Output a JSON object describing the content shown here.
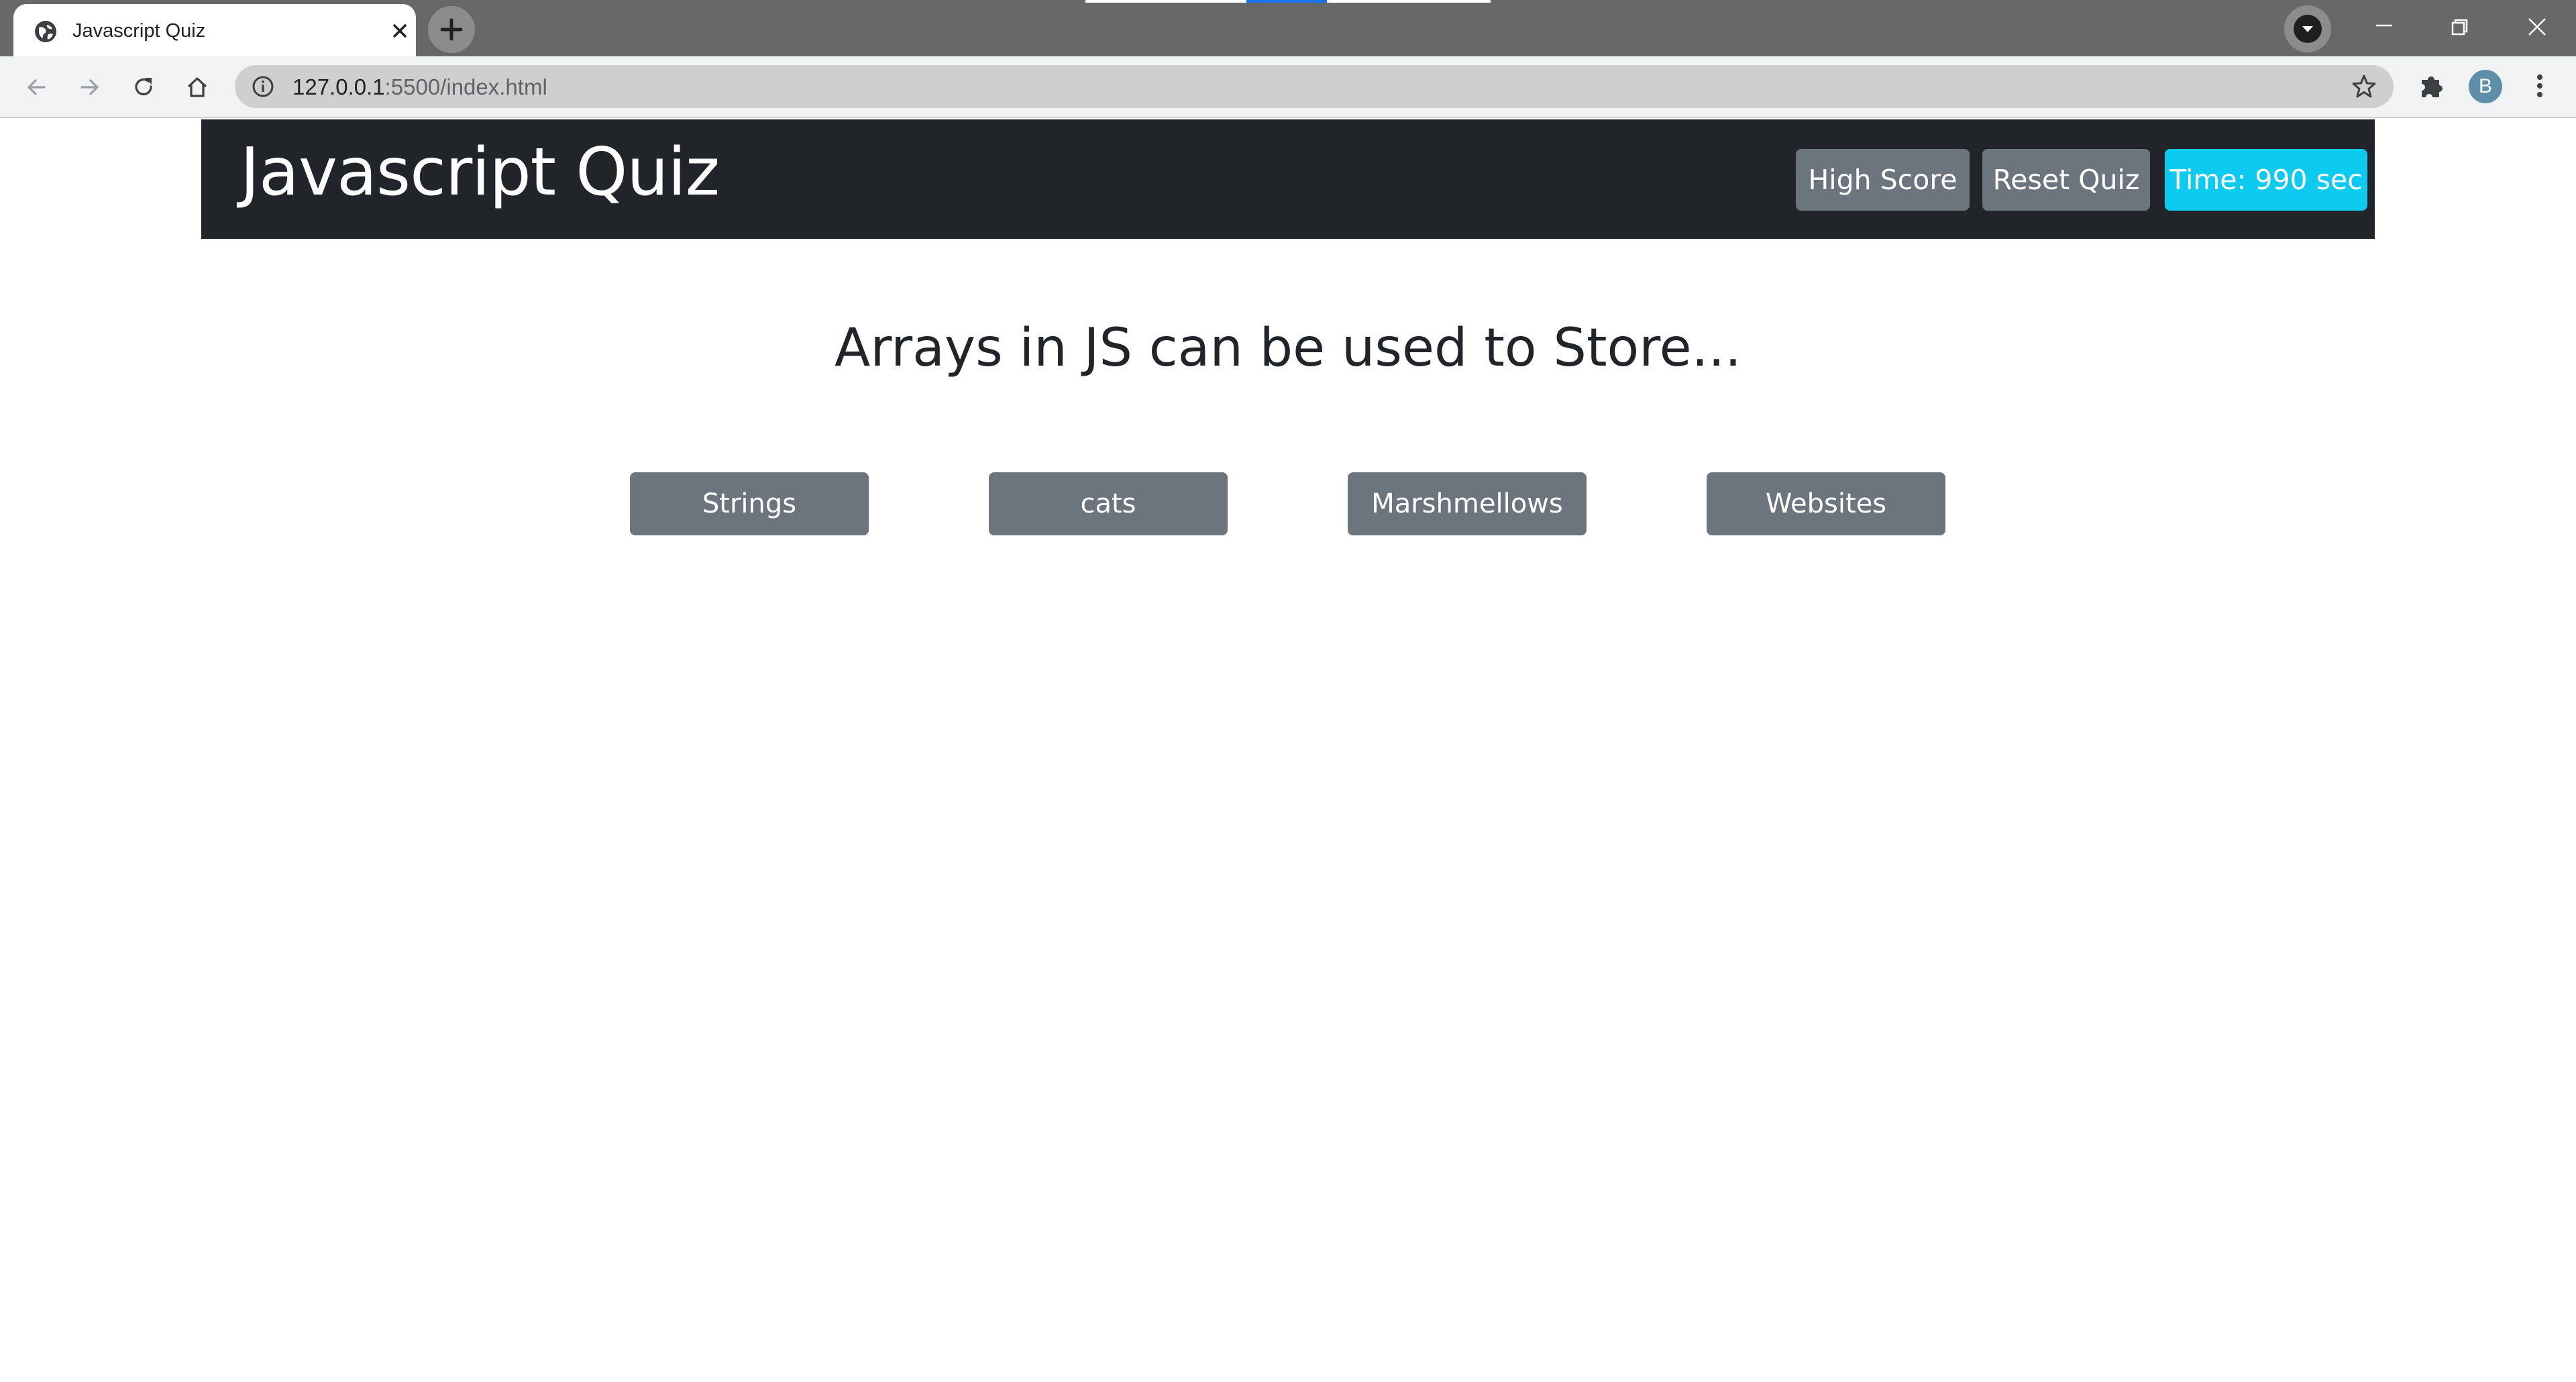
{
  "browser": {
    "tab": {
      "title": "Javascript Quiz",
      "favicon": "globe-icon",
      "close_icon": "close-icon"
    },
    "new_tab_icon": "plus-icon",
    "profile_dropdown_icon": "chevron-down-icon",
    "window_controls": [
      "minimize-icon",
      "restore-icon",
      "close-icon"
    ],
    "toolbar": {
      "back_icon": "back-arrow-icon",
      "forward_icon": "forward-arrow-icon",
      "reload_icon": "reload-icon",
      "home_icon": "home-icon",
      "url_host": "127.0.0.1",
      "url_rest": ":5500/index.html",
      "site_info_icon": "info-icon",
      "bookmark_icon": "star-icon",
      "extensions_icon": "puzzle-icon",
      "avatar_letter": "B",
      "menu_icon": "kebab-menu-icon"
    }
  },
  "quiz": {
    "brand": "Javascript Quiz",
    "buttons": {
      "high_score": "High Score",
      "reset": "Reset Quiz",
      "timer": "Time: 990 sec"
    },
    "question": "Arrays in JS can be used to Store...",
    "answers": [
      "Strings",
      "cats",
      "Marshmellows",
      "Websites"
    ]
  },
  "colors": {
    "navbar": "#212529",
    "secondary_button": "#6c757d",
    "timer_button": "#0dcaf0",
    "tabstrip": "#686868",
    "omnibox": "#cfcfcf"
  }
}
